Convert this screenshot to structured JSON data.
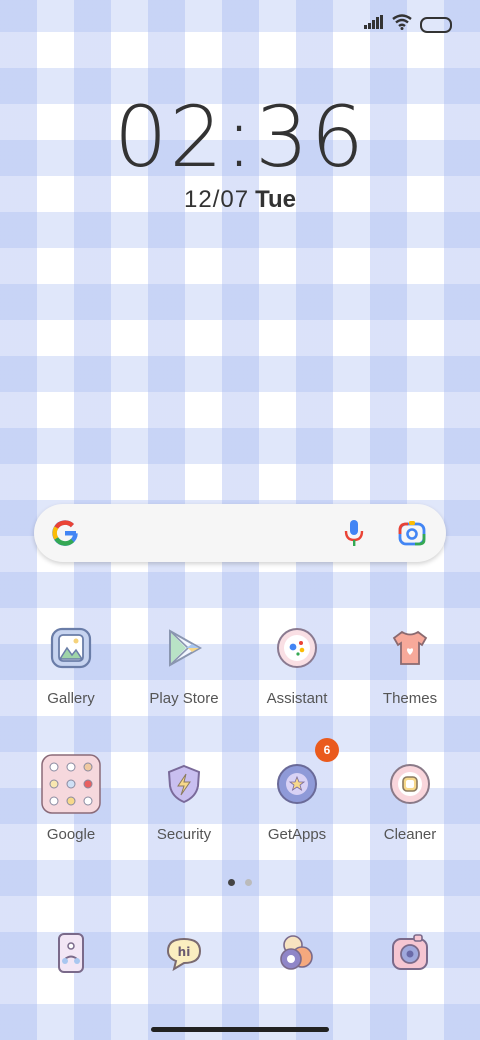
{
  "status_bar": {
    "signal": "signal-icon",
    "wifi": "wifi-icon",
    "battery": "battery-icon"
  },
  "clock": {
    "time": "02:36",
    "date": "12/07",
    "weekday": "Tue"
  },
  "search": {
    "icons": [
      "google-logo-icon",
      "microphone-icon",
      "google-lens-icon"
    ]
  },
  "apps": [
    {
      "label": "Gallery",
      "icon": "gallery-icon"
    },
    {
      "label": "Play Store",
      "icon": "play-store-icon"
    },
    {
      "label": "Assistant",
      "icon": "assistant-icon"
    },
    {
      "label": "Themes",
      "icon": "themes-icon"
    },
    {
      "label": "Google",
      "icon": "google-folder-icon"
    },
    {
      "label": "Security",
      "icon": "security-icon"
    },
    {
      "label": "GetApps",
      "icon": "getapps-icon",
      "badge": "6"
    },
    {
      "label": "Cleaner",
      "icon": "cleaner-icon"
    }
  ],
  "page_indicator": {
    "pages": 2,
    "current": 1
  },
  "dock": [
    "phone-icon",
    "messages-icon",
    "browser-icon",
    "camera-icon"
  ],
  "colors": {
    "badge": "#ea5a1c",
    "icon_outline": "#7a6a8a"
  }
}
